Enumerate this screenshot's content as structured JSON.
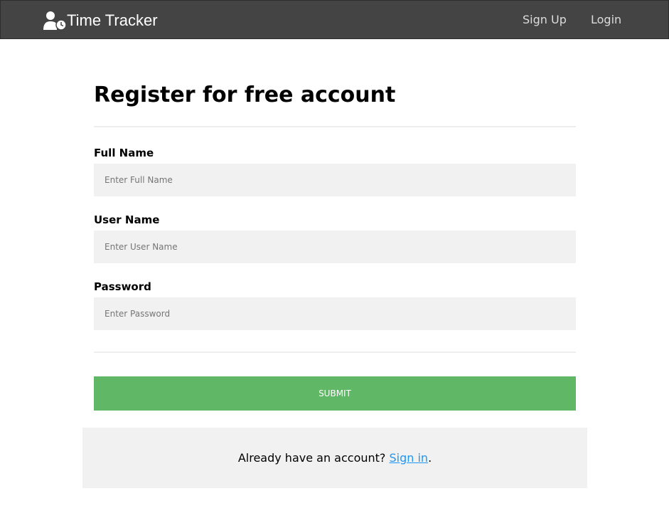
{
  "navbar": {
    "brand": "Time Tracker",
    "brand_icon": "user-clock-icon",
    "links": [
      {
        "label": "Sign Up"
      },
      {
        "label": "Login"
      }
    ]
  },
  "form": {
    "title": "Register for free account",
    "fields": [
      {
        "label": "Full Name",
        "placeholder": "Enter Full Name",
        "value": ""
      },
      {
        "label": "User Name",
        "placeholder": "Enter User Name",
        "value": ""
      },
      {
        "label": "Password",
        "placeholder": "Enter Password",
        "value": ""
      }
    ],
    "submit_label": "SUBMIT"
  },
  "signin": {
    "prompt": "Already have an account? ",
    "link_label": "Sign in",
    "suffix": "."
  },
  "colors": {
    "navbar_bg": "#444444",
    "submit_bg": "#60b866",
    "link": "#2196F3",
    "input_bg": "#f1f1f1"
  }
}
